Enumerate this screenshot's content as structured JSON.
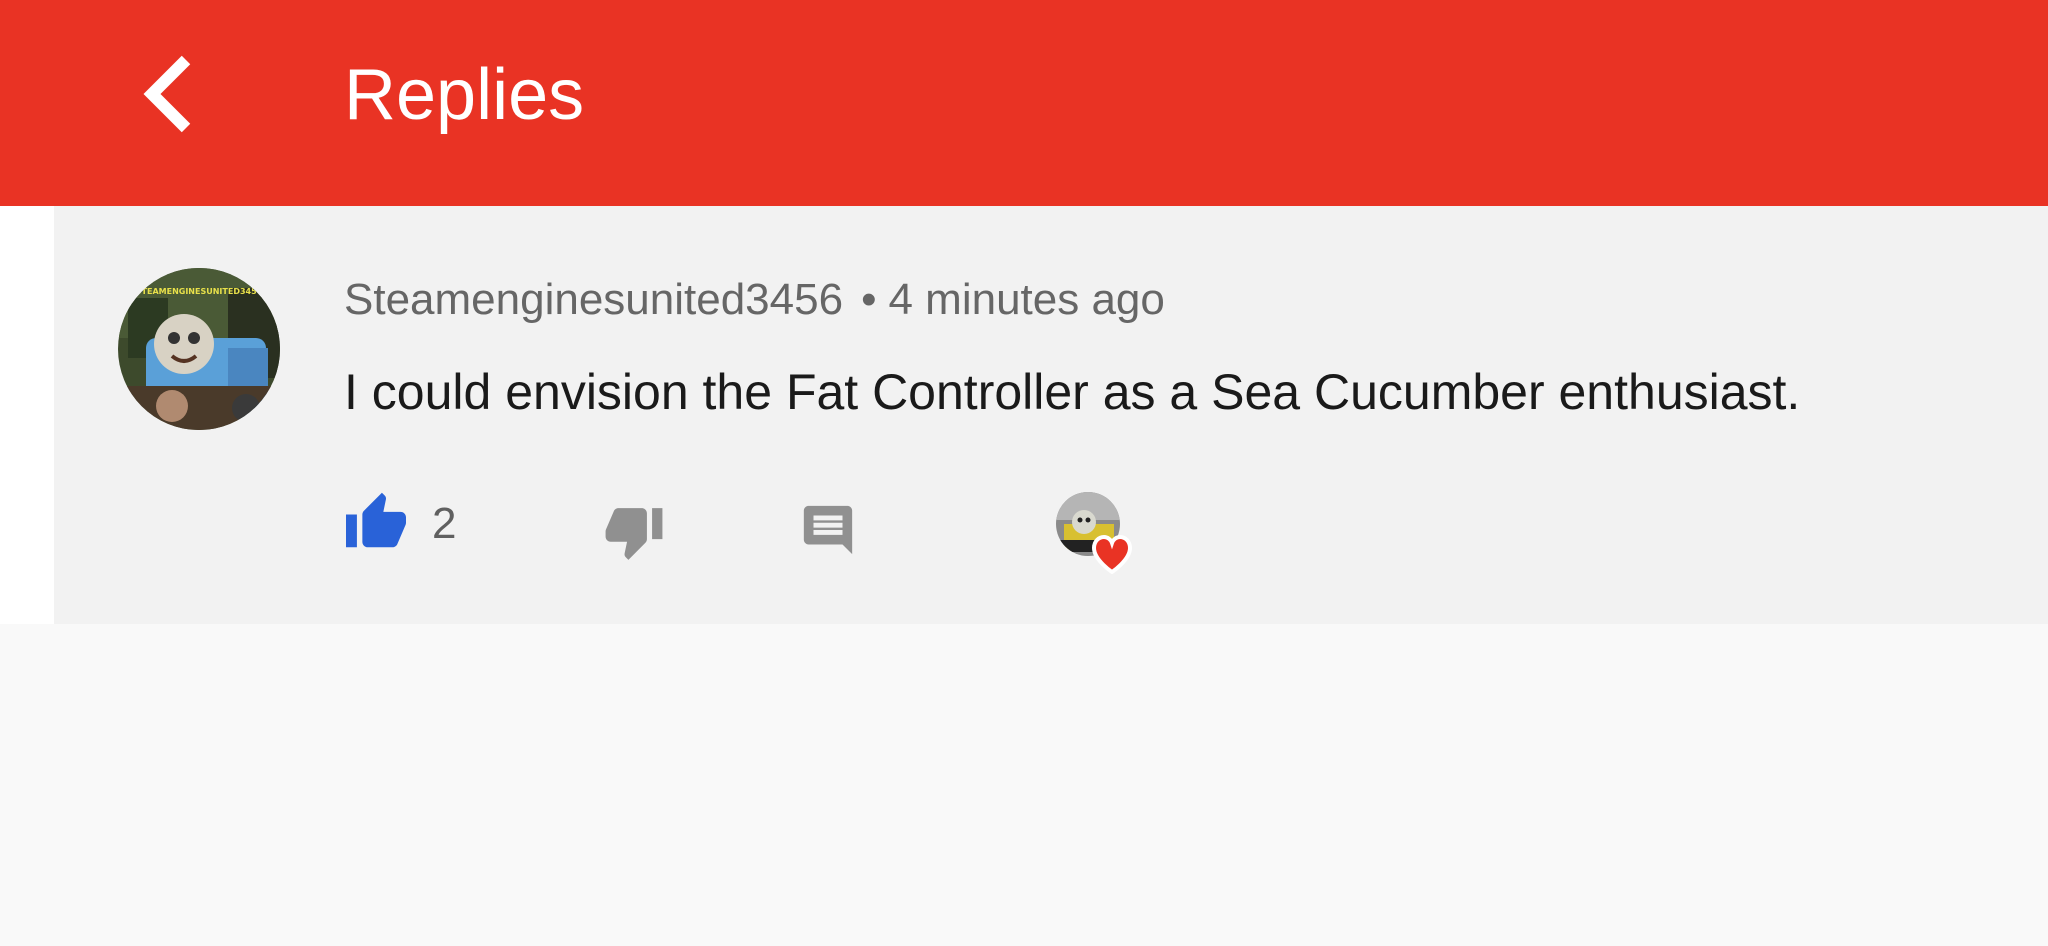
{
  "app_bar": {
    "title": "Replies",
    "background_color": "#e93324",
    "back_icon": "chevron-left-icon"
  },
  "comment": {
    "author": "Steamenginesunited3456",
    "separator": "•",
    "timestamp": "4 minutes ago",
    "text": "I could envision the Fat Controller as a Sea Cucumber enthusiast.",
    "like_count": "2",
    "avatar_banner_text": "STEAMENGINESUNITED3456",
    "icons": {
      "like": "thumbs-up-icon",
      "dislike": "thumbs-down-icon",
      "reply": "reply-comment-icon",
      "creator_heart": "creator-heart-icon"
    },
    "like_color": "#2962d8",
    "heart_color": "#e93324"
  }
}
